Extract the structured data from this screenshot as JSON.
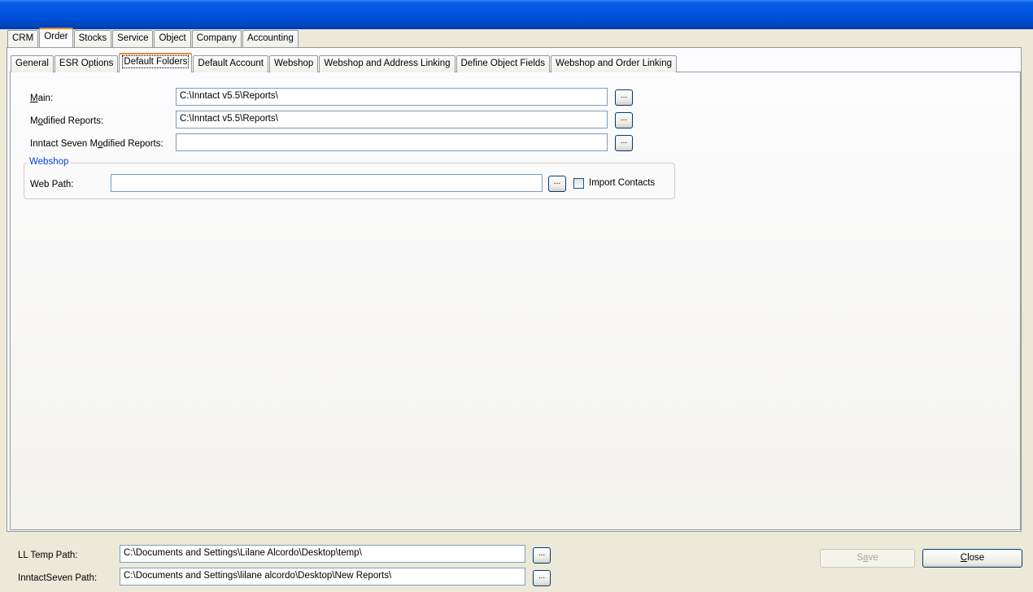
{
  "main_tabs": [
    "CRM",
    "Order",
    "Stocks",
    "Service",
    "Object",
    "Company",
    "Accounting"
  ],
  "sub_tabs": [
    "General",
    "ESR Options",
    "Default Folders",
    "Default Account",
    "Webshop",
    "Webshop and Address Linking",
    "Define Object Fields",
    "Webshop and Order Linking"
  ],
  "folders": {
    "main_label_first": "M",
    "main_label_rest": "ain:",
    "main_value": "C:\\Inntact v5.5\\Reports\\",
    "modified_label_first": "M",
    "modified_label_u": "o",
    "modified_label_rest": "dified Reports:",
    "modified_value": "C:\\Inntact v5.5\\Reports\\",
    "seven_label_pre": "Inntact Seven M",
    "seven_label_u": "o",
    "seven_label_rest": "dified Reports:",
    "seven_value": ""
  },
  "webshop": {
    "group_title": "Webshop",
    "web_path_label": "Web Path:",
    "web_path_value": "",
    "import_contacts_label": "Import Contacts"
  },
  "browse_label": "...",
  "footer": {
    "ll_temp_label": "LL Temp Path:",
    "ll_temp_value": "C:\\Documents and Settings\\Lilane Alcordo\\Desktop\\temp\\",
    "inntactseven_label": "InntactSeven Path:",
    "inntactseven_value": "C:\\Documents and Settings\\lilane alcordo\\Desktop\\New Reports\\",
    "save_label_pre": "S",
    "save_label_u": "a",
    "save_label_rest": "ve",
    "close_label_u": "C",
    "close_label_rest": "lose"
  }
}
